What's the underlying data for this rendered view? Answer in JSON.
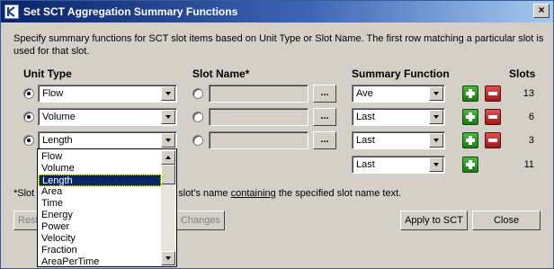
{
  "window": {
    "title": "Set SCT Aggregation Summary Functions",
    "close_label": "×"
  },
  "description": "Specify summary functions for SCT slot items based on Unit Type or Slot Name. The first row matching a particular slot is used for that slot.",
  "headers": {
    "unit_type": "Unit Type",
    "slot_name": "Slot Name*",
    "summary_function": "Summary Function",
    "slots": "Slots"
  },
  "rows": [
    {
      "unit_type": "Flow",
      "function": "Ave",
      "count": "13"
    },
    {
      "unit_type": "Volume",
      "function": "Last",
      "count": "6"
    },
    {
      "unit_type": "Length",
      "function": "Last",
      "count": "3"
    }
  ],
  "default_row": {
    "function": "Last",
    "count": "11"
  },
  "browse_label": "...",
  "note": {
    "prefix": "*Slot",
    "middle": "slot's name",
    "underlined": "containing",
    "suffix": "the specified slot name text."
  },
  "buttons": {
    "reset": "Rest",
    "changes": "Changes",
    "apply": "Apply to SCT",
    "close": "Close"
  },
  "dropdown_options": [
    "Flow",
    "Volume",
    "Length",
    "Area",
    "Time",
    "Energy",
    "Power",
    "Velocity",
    "Fraction",
    "AreaPerTime"
  ],
  "dropdown_selected": "Length",
  "colors": {
    "title_bar": "#0a246a",
    "selection": "#0a246a",
    "dialog": "#d4d0c8"
  }
}
